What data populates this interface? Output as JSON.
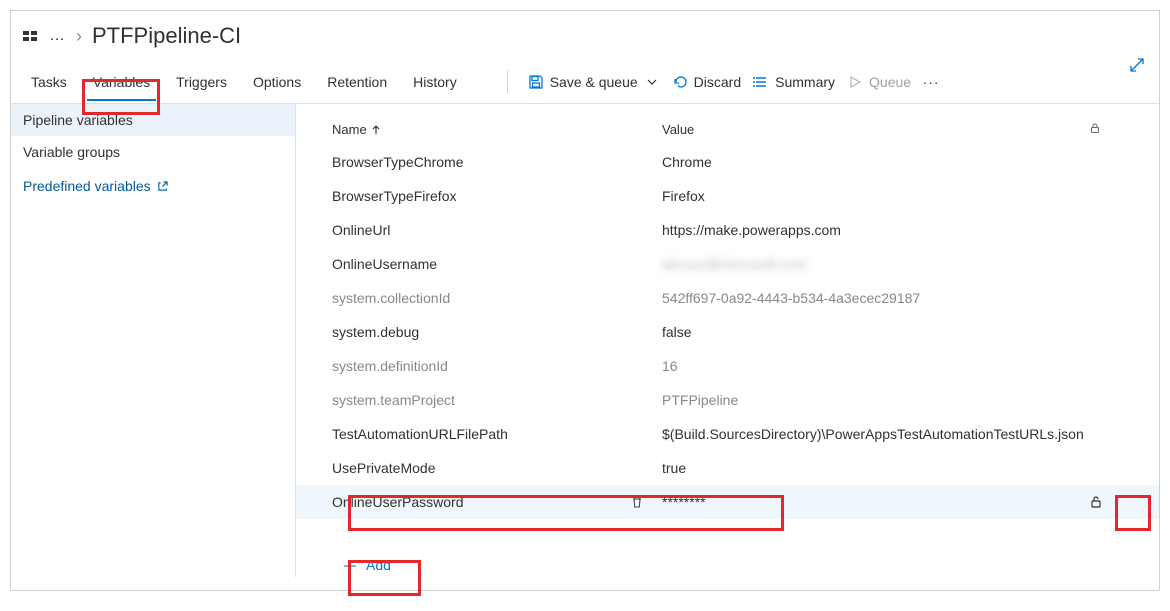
{
  "breadcrumb": {
    "title": "PTFPipeline-CI"
  },
  "tabs": [
    {
      "id": "tasks",
      "label": "Tasks"
    },
    {
      "id": "variables",
      "label": "Variables",
      "active": true
    },
    {
      "id": "triggers",
      "label": "Triggers"
    },
    {
      "id": "options",
      "label": "Options"
    },
    {
      "id": "retention",
      "label": "Retention"
    },
    {
      "id": "history",
      "label": "History"
    }
  ],
  "toolbar": {
    "save_queue": "Save & queue",
    "discard": "Discard",
    "summary": "Summary",
    "queue": "Queue"
  },
  "side": {
    "pipeline_vars": "Pipeline variables",
    "variable_groups": "Variable groups",
    "predefined": "Predefined variables"
  },
  "grid": {
    "name_header": "Name",
    "value_header": "Value"
  },
  "variables": [
    {
      "name": "BrowserTypeChrome",
      "value": "Chrome",
      "type": "user"
    },
    {
      "name": "BrowserTypeFirefox",
      "value": "Firefox",
      "type": "user"
    },
    {
      "name": "OnlineUrl",
      "value": "https://make.powerapps.com",
      "type": "user"
    },
    {
      "name": "OnlineUsername",
      "value": "abcxyz@microsoft.com",
      "type": "user",
      "blurred": true
    },
    {
      "name": "system.collectionId",
      "value": "542ff697-0a92-4443-b534-4a3ecec29187",
      "type": "system"
    },
    {
      "name": "system.debug",
      "value": "false",
      "type": "user"
    },
    {
      "name": "system.definitionId",
      "value": "16",
      "type": "system"
    },
    {
      "name": "system.teamProject",
      "value": "PTFPipeline",
      "type": "system"
    },
    {
      "name": "TestAutomationURLFilePath",
      "value": "$(Build.SourcesDirectory)\\PowerAppsTestAutomationTestURLs.json",
      "type": "user"
    },
    {
      "name": "UsePrivateMode",
      "value": "true",
      "type": "user"
    },
    {
      "name": "OnlineUserPassword",
      "value": "********",
      "type": "user",
      "selected": true,
      "secret": true
    }
  ],
  "add_label": "Add"
}
